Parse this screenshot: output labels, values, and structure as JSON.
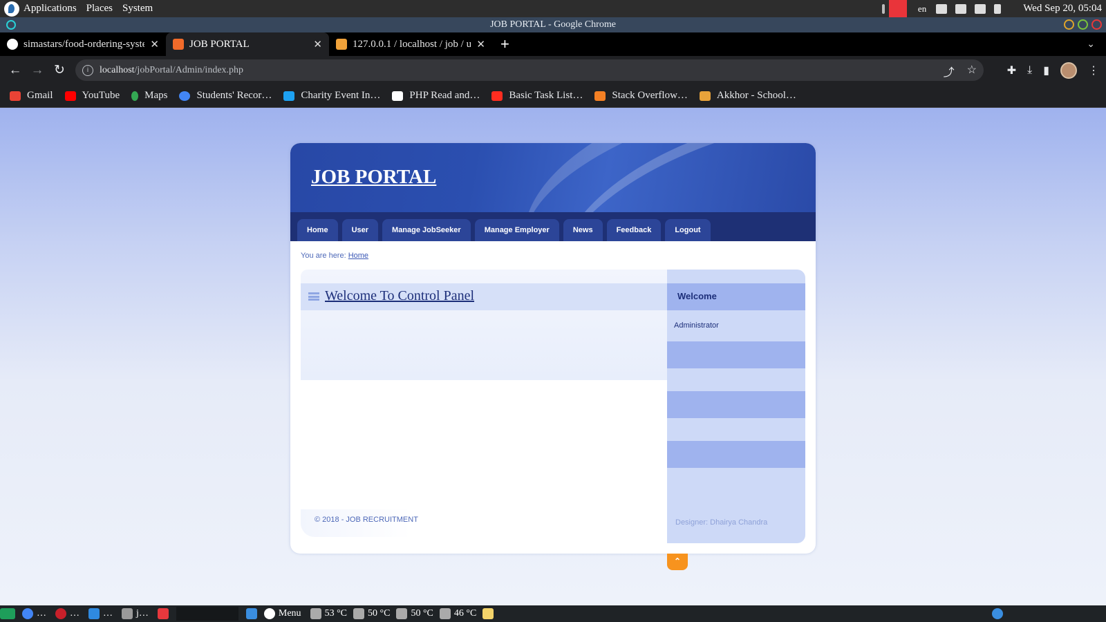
{
  "system_panel": {
    "menu": [
      "Applications",
      "Places",
      "System"
    ],
    "lang": "en",
    "clock": "Wed Sep 20, 05:04"
  },
  "window": {
    "title": "JOB PORTAL - Google Chrome"
  },
  "tabs": [
    {
      "title": "simastars/food-ordering-system",
      "favicon": "github-icon",
      "color": "#ffffff"
    },
    {
      "title": "JOB PORTAL",
      "favicon": "xampp-icon",
      "color": "#f26b2a"
    },
    {
      "title": "127.0.0.1 / localhost / job / u",
      "favicon": "phpmyadmin-icon",
      "color": "#f0a23a"
    }
  ],
  "omnibox": {
    "host": "localhost",
    "path": "/jobPortal/Admin/index.php"
  },
  "bookmarks": [
    {
      "label": "Gmail",
      "color": "#ea4335"
    },
    {
      "label": "YouTube",
      "color": "#ff0000"
    },
    {
      "label": "Maps",
      "color": "#34a853"
    },
    {
      "label": "Students' Recor…",
      "color": "#4285f4"
    },
    {
      "label": "Charity Event In…",
      "color": "#1da1f2"
    },
    {
      "label": "PHP Read and…",
      "color": "#ffffff"
    },
    {
      "label": "Basic Task List…",
      "color": "#ff2d20"
    },
    {
      "label": "Stack Overflow…",
      "color": "#f48024"
    },
    {
      "label": "Akkhor - School…",
      "color": "#e8a23a"
    }
  ],
  "site": {
    "title": "JOB PORTAL",
    "nav": [
      "Home",
      "User",
      "Manage JobSeeker",
      "Manage Employer",
      "News",
      "Feedback",
      "Logout"
    ],
    "crumb_prefix": "You are here: ",
    "crumb_link": "Home",
    "content_title": "Welcome To Control Panel",
    "sidebar_title": "Welcome",
    "sidebar_user": "Administrator",
    "footer": "© 2018 - JOB RECRUITMENT",
    "designer": "Designer: Dhairya Chandra",
    "to_top": "⌃"
  },
  "taskbar": {
    "items": [
      "…",
      "…",
      "…",
      "j…"
    ],
    "menu": "Menu",
    "temps": [
      "53 °C",
      "50 °C",
      "50 °C",
      "46 °C"
    ]
  }
}
